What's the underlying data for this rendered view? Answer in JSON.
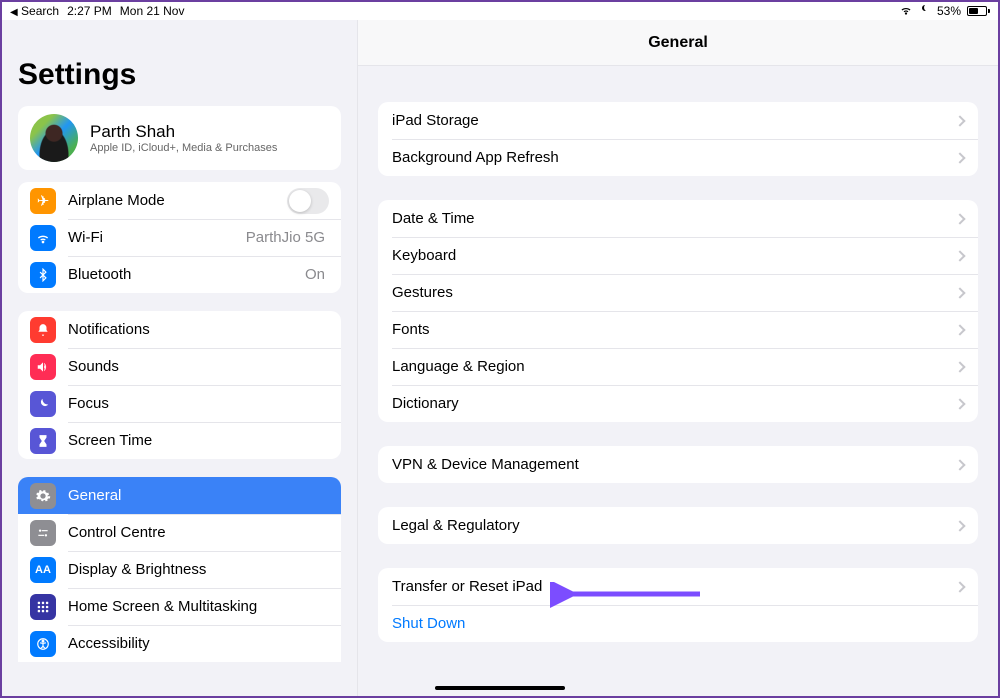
{
  "status": {
    "back_label": "Search",
    "time": "2:27 PM",
    "date": "Mon 21 Nov",
    "battery_pct": "53%"
  },
  "sidebar": {
    "title": "Settings",
    "profile": {
      "name": "Parth Shah",
      "subtitle": "Apple ID, iCloud+, Media & Purchases"
    },
    "net": {
      "airplane": "Airplane Mode",
      "wifi": "Wi-Fi",
      "wifi_val": "ParthJio 5G",
      "bluetooth": "Bluetooth",
      "bluetooth_val": "On"
    },
    "alerts": {
      "notifications": "Notifications",
      "sounds": "Sounds",
      "focus": "Focus",
      "screentime": "Screen Time"
    },
    "device": {
      "general": "General",
      "control_centre": "Control Centre",
      "display": "Display & Brightness",
      "homescreen": "Home Screen & Multitasking",
      "accessibility": "Accessibility"
    }
  },
  "detail": {
    "title": "General",
    "g1": {
      "storage": "iPad Storage",
      "bg_refresh": "Background App Refresh"
    },
    "g2": {
      "datetime": "Date & Time",
      "keyboard": "Keyboard",
      "gestures": "Gestures",
      "fonts": "Fonts",
      "lang_region": "Language & Region",
      "dictionary": "Dictionary"
    },
    "g3": {
      "vpn": "VPN & Device Management"
    },
    "g4": {
      "legal": "Legal & Regulatory"
    },
    "g5": {
      "transfer_reset": "Transfer or Reset iPad",
      "shutdown": "Shut Down"
    }
  }
}
